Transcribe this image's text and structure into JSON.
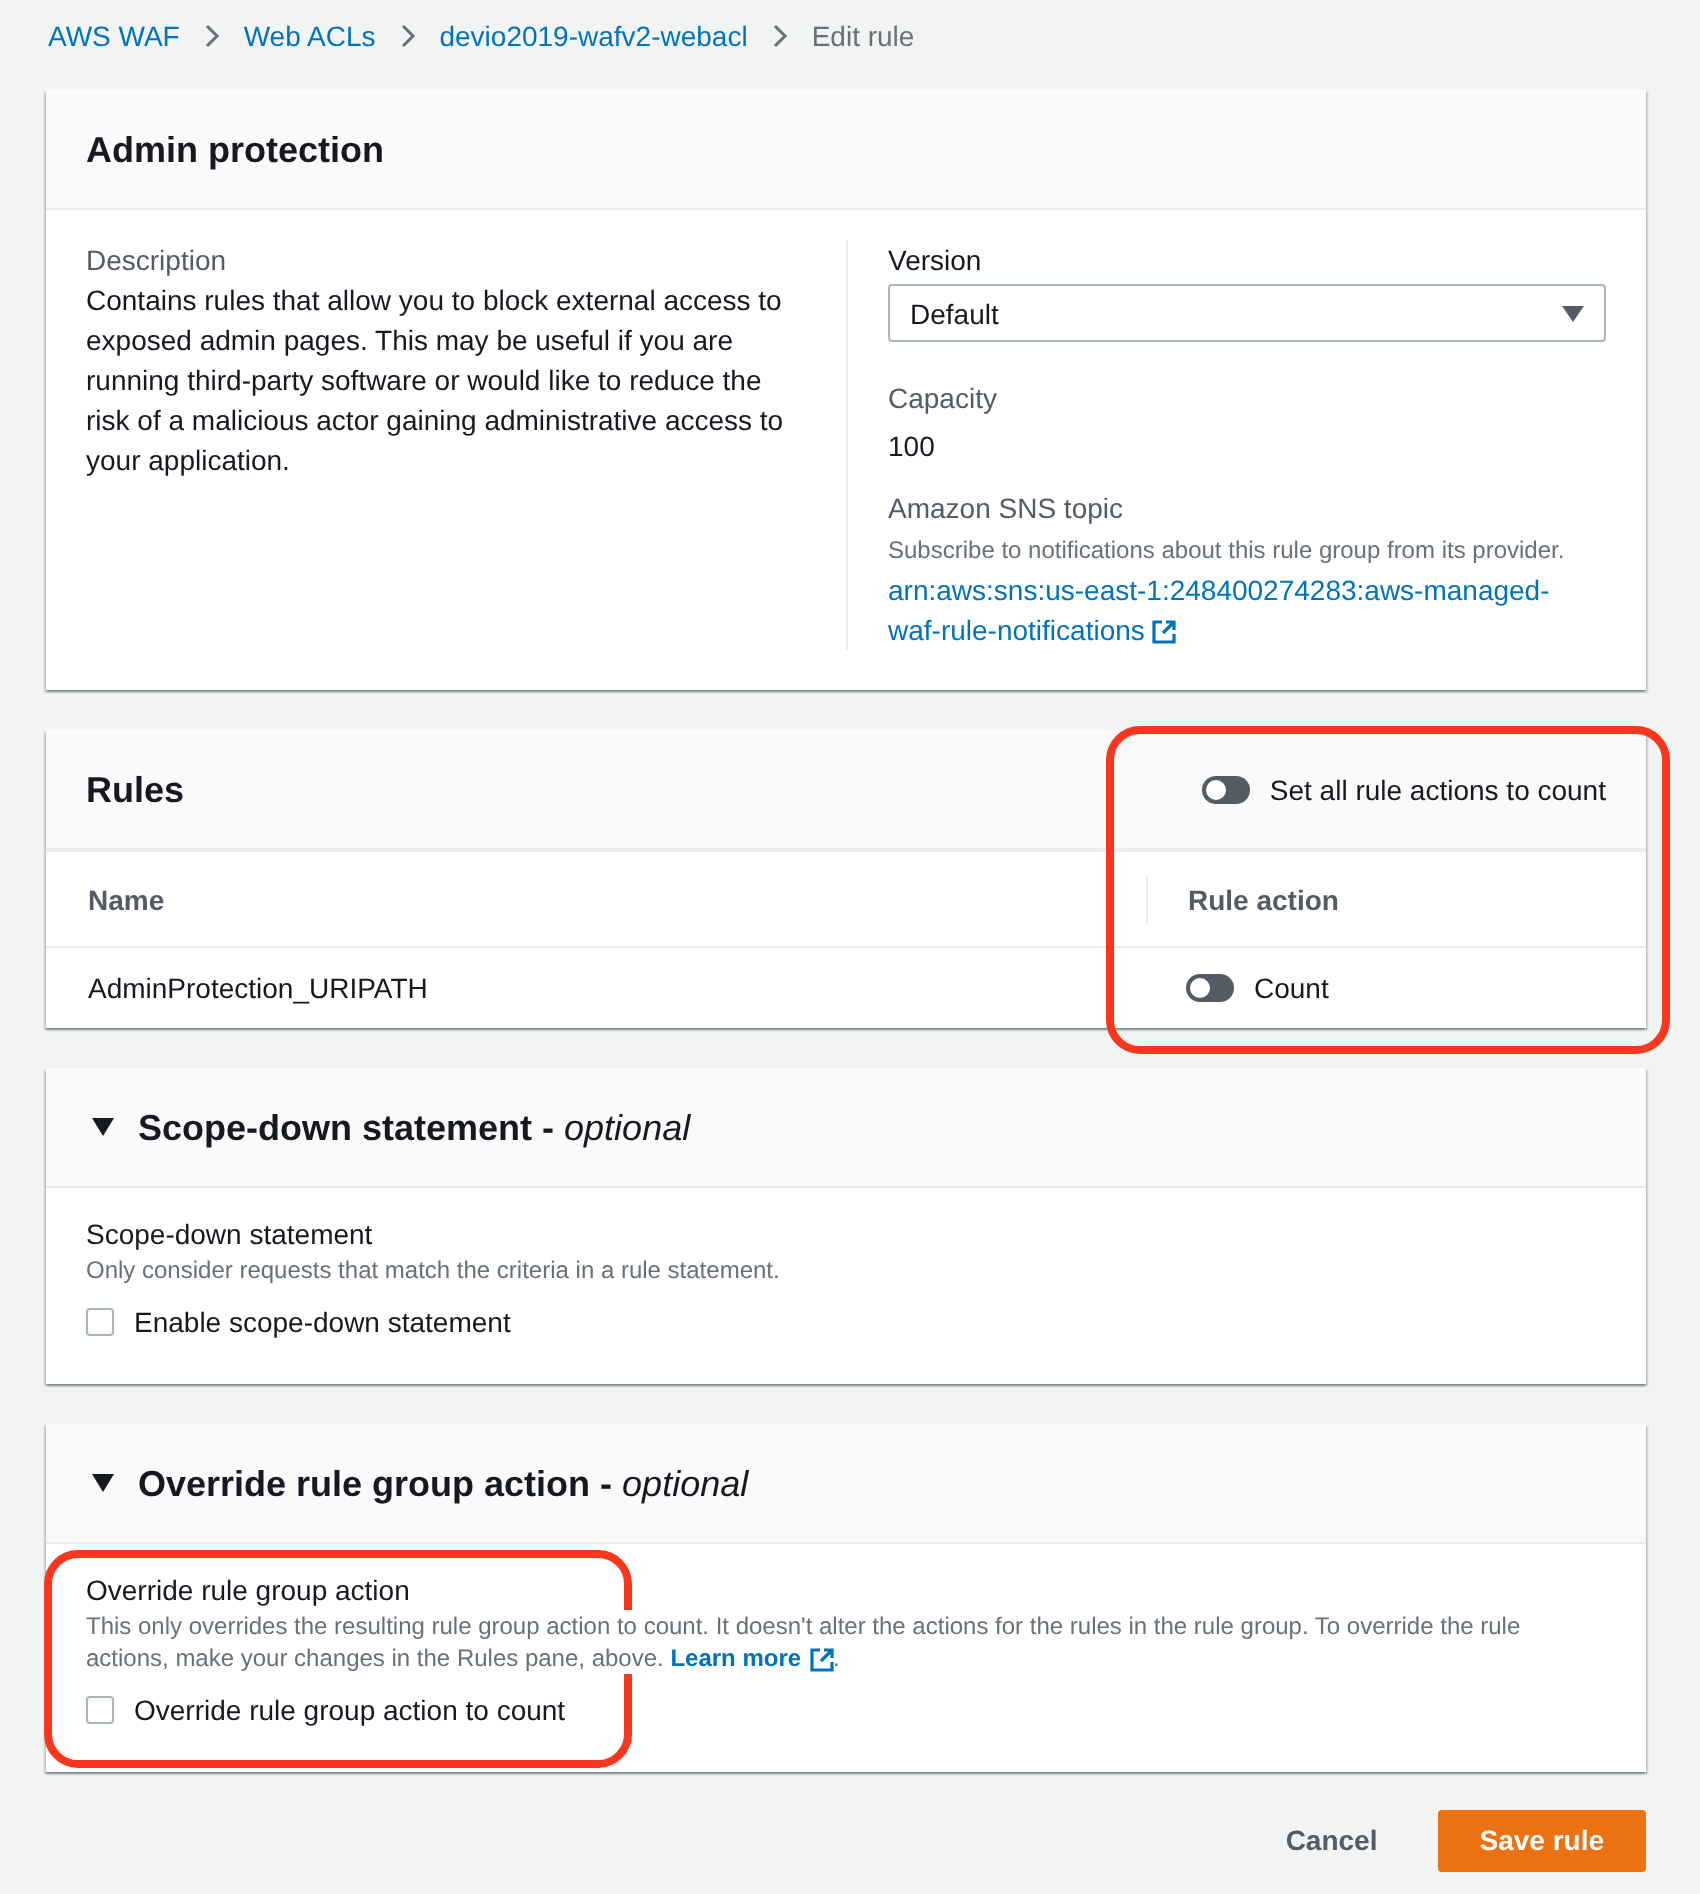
{
  "breadcrumb": [
    {
      "label": "AWS WAF",
      "current": false
    },
    {
      "label": "Web ACLs",
      "current": false
    },
    {
      "label": "devio2019-wafv2-webacl",
      "current": false
    },
    {
      "label": "Edit rule",
      "current": true
    }
  ],
  "rule_group": {
    "title": "Admin protection",
    "description_label": "Description",
    "description": "Contains rules that allow you to block external access to exposed admin pages. This may be useful if you are running third-party software or would like to reduce the risk of a malicious actor gaining administrative access to your application.",
    "version": {
      "label": "Version",
      "value": "Default"
    },
    "capacity": {
      "label": "Capacity",
      "value": "100"
    },
    "sns_topic": {
      "label": "Amazon SNS topic",
      "hint": "Subscribe to notifications about this rule group from its provider.",
      "link": "arn:aws:sns:us-east-1:248400274283:aws-managed-waf-rule-notifications"
    }
  },
  "rules": {
    "title": "Rules",
    "highlighted": true,
    "set_all": {
      "label": "Set all rule actions to count",
      "on": false
    },
    "columns": [
      "Name",
      "Rule action"
    ],
    "rows": [
      {
        "name": "AdminProtection_URIPATH",
        "action": {
          "label": "Count",
          "on": false
        }
      }
    ]
  },
  "sections": [
    {
      "title": "Scope-down statement - *optional*",
      "expanded": true,
      "highlighted": false,
      "field_label": "Scope-down statement",
      "hint": "Only consider requests that match the criteria in a rule statement.",
      "checkbox": {
        "label": "Enable scope-down statement",
        "checked": false
      }
    },
    {
      "title": "Override rule group action - *optional*",
      "expanded": true,
      "highlighted": true,
      "field_label": "Override rule group action",
      "hint": "This only overrides the resulting rule group action to count. It doesn't alter the actions for the rules in the rule group. To override the rule actions, make your changes in the Rules pane, above.",
      "link": "Learn more",
      "hint_end": ".",
      "checkbox": {
        "label": "Override rule group action to count",
        "checked": false
      }
    }
  ],
  "buttons": [
    {
      "label": "Cancel",
      "kind": "link"
    },
    {
      "label": "Save rule",
      "kind": "primary"
    }
  ]
}
